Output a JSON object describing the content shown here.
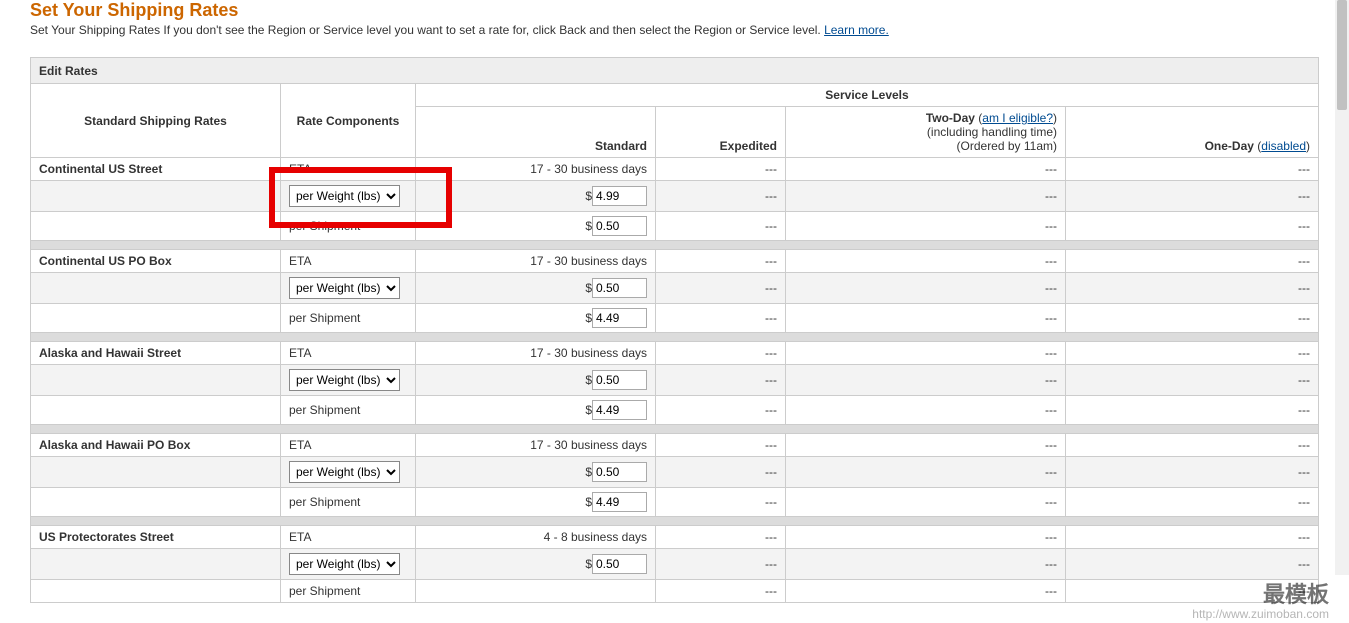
{
  "header": {
    "title": "Set Your Shipping Rates",
    "subtext_prefix": "Set Your Shipping Rates If you don't see the Region or Service level you want to set a rate for, click Back and then select the Region or Service level. ",
    "learn_more": "Learn more."
  },
  "table": {
    "edit_rates": "Edit Rates",
    "std_rates": "Standard Shipping Rates",
    "rate_components": "Rate Components",
    "service_levels": "Service Levels",
    "cols": {
      "standard": "Standard",
      "expedited": "Expedited",
      "two_day_label": "Two-Day",
      "two_day_link": "am I eligible?",
      "two_day_line2": "(including handling time)",
      "two_day_line3": "(Ordered by 11am)",
      "one_day_label": "One-Day",
      "one_day_link": "disabled"
    }
  },
  "components": {
    "eta": "ETA",
    "per_weight": "per Weight (lbs)",
    "per_shipment": "per Shipment"
  },
  "dash": "---",
  "currency": "$",
  "regions": [
    {
      "name": "Continental US Street",
      "eta": "17 - 30 business days",
      "weight_val": "4.99",
      "ship_val": "0.50",
      "highlight_weight": true
    },
    {
      "name": "Continental US PO Box",
      "eta": "17 - 30 business days",
      "weight_val": "0.50",
      "ship_val": "4.49"
    },
    {
      "name": "Alaska and Hawaii Street",
      "eta": "17 - 30 business days",
      "weight_val": "0.50",
      "ship_val": "4.49"
    },
    {
      "name": "Alaska and Hawaii PO Box",
      "eta": "17 - 30 business days",
      "weight_val": "0.50",
      "ship_val": "4.49"
    },
    {
      "name": "US Protectorates Street",
      "eta": "4 - 8 business days",
      "weight_val": "0.50",
      "ship_val": ""
    }
  ],
  "watermark": {
    "text1": "最模板",
    "text2": "http://www.zuimoban.com"
  }
}
